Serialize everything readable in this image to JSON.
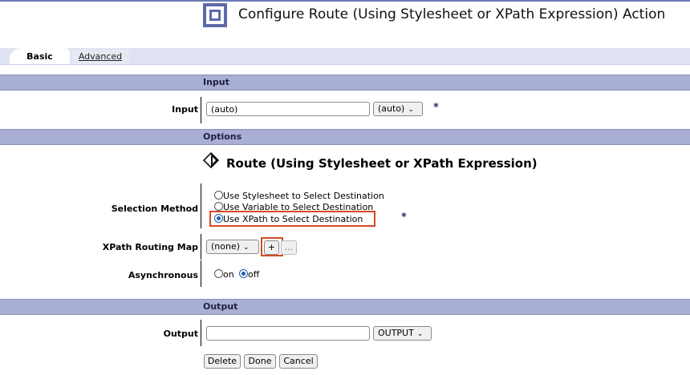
{
  "header": {
    "title": "Configure Route (Using Stylesheet or XPath Expression) Action"
  },
  "tabs": [
    {
      "label": "Basic"
    },
    {
      "label": "Advanced"
    }
  ],
  "sections": {
    "input": "Input",
    "options": "Options",
    "output": "Output"
  },
  "input": {
    "label": "Input",
    "value": "(auto)",
    "select": "(auto)",
    "required": "*"
  },
  "options": {
    "heading": "Route (Using Stylesheet or XPath Expression)",
    "selection_method": {
      "label": "Selection Method",
      "options": [
        "Use Stylesheet to Select Destination",
        "Use Variable to Select Destination",
        "Use XPath to Select Destination"
      ],
      "selected_index": 2,
      "required": "*"
    },
    "routing_map": {
      "label": "XPath Routing Map",
      "select": "(none)",
      "add": "+",
      "more": "..."
    },
    "asynchronous": {
      "label": "Asynchronous",
      "on": "on",
      "off": "off",
      "selected": "off"
    }
  },
  "output": {
    "label": "Output",
    "value": "",
    "select": "OUTPUT"
  },
  "buttons": {
    "delete": "Delete",
    "done": "Done",
    "cancel": "Cancel"
  },
  "colors": {
    "section": "#a9aed4",
    "tabbar": "#dfe3f4",
    "highlight": "#d64a24",
    "icon": "#5e6aa8"
  }
}
